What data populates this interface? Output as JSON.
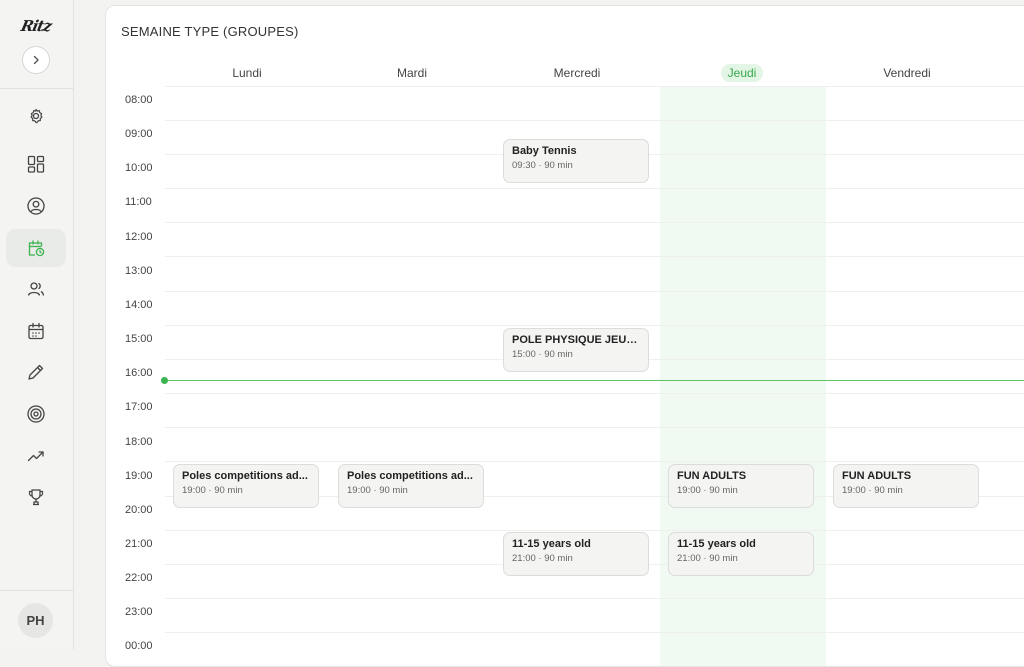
{
  "sidebar": {
    "logo": "Ritz",
    "nav": [
      {
        "name": "settings-icon"
      },
      {
        "name": "dashboard-icon"
      },
      {
        "name": "profile-icon"
      },
      {
        "name": "calendar-clock-icon",
        "active": true
      },
      {
        "name": "users-icon"
      },
      {
        "name": "calendar-icon"
      },
      {
        "name": "pencil-icon"
      },
      {
        "name": "target-icon"
      },
      {
        "name": "trending-up-icon"
      },
      {
        "name": "trophy-icon"
      }
    ],
    "avatar_initials": "PH"
  },
  "schedule": {
    "title": "SEMAINE TYPE (GROUPES)",
    "days": [
      "Lundi",
      "Mardi",
      "Mercredi",
      "Jeudi",
      "Vendredi"
    ],
    "today": "Jeudi",
    "hours": [
      "08:00",
      "09:00",
      "10:00",
      "11:00",
      "12:00",
      "13:00",
      "14:00",
      "15:00",
      "16:00",
      "17:00",
      "18:00",
      "19:00",
      "20:00",
      "21:00",
      "22:00",
      "23:00",
      "00:00"
    ],
    "events": [
      {
        "day": "Mercredi",
        "title": "Baby Tennis",
        "meta": "09:30 · 90 min"
      },
      {
        "day": "Mercredi",
        "title": "POLE PHYSIQUE JEUN...",
        "meta": "15:00 · 90 min"
      },
      {
        "day": "Lundi",
        "title": "Poles competitions ad...",
        "meta": "19:00 · 90 min"
      },
      {
        "day": "Mardi",
        "title": "Poles competitions ad...",
        "meta": "19:00 · 90 min"
      },
      {
        "day": "Jeudi",
        "title": "FUN ADULTS",
        "meta": "19:00 · 90 min"
      },
      {
        "day": "Vendredi",
        "title": "FUN ADULTS",
        "meta": "19:00 · 90 min"
      },
      {
        "day": "Mercredi",
        "title": "11-15 years old",
        "meta": "21:00 · 90 min"
      },
      {
        "day": "Jeudi",
        "title": "11-15 years old",
        "meta": "21:00 · 90 min"
      }
    ],
    "accent_color": "#3cb34f"
  }
}
